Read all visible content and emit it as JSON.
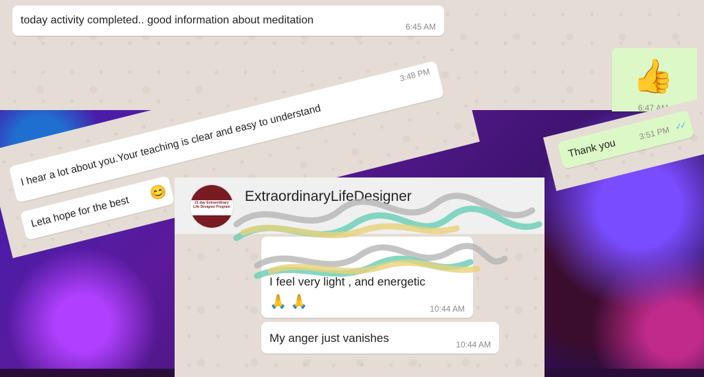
{
  "messages": {
    "m1": {
      "text": "today activity completed..  good information about meditation",
      "time": "6:45 AM"
    },
    "m2": {
      "emoji": "👍",
      "time": "6:47 AM",
      "ticks": "✓✓"
    },
    "m3": {
      "text": "I hear a lot about you.Your teaching is clear and easy to understand",
      "time": "3:48 PM"
    },
    "m4": {
      "text": "Leta hope for the best",
      "emoji": "😊"
    },
    "m5": {
      "text": "Thank you",
      "time": "3:51 PM",
      "ticks": "✓✓"
    }
  },
  "group_card": {
    "name": "ExtraordinaryLifeDesigner",
    "logo_text": "21 day Extraordinary Life Designer Program",
    "messages": [
      {
        "text": "I feel very light , and energetic",
        "emoji": "🙏 🙏",
        "time": "10:44 AM"
      },
      {
        "text": "My anger just vanishes",
        "time": "10:44 AM"
      }
    ]
  },
  "colors": {
    "chat_bg": "#e5ddd5",
    "incoming": "#ffffff",
    "outgoing": "#dcf8c6",
    "tick_blue": "#4fb6ec",
    "logo_maroon": "#7a1a22",
    "scribble_gray": "#b5b5b5",
    "scribble_yellow": "#e8d27a",
    "scribble_teal": "#6fd0b8"
  }
}
